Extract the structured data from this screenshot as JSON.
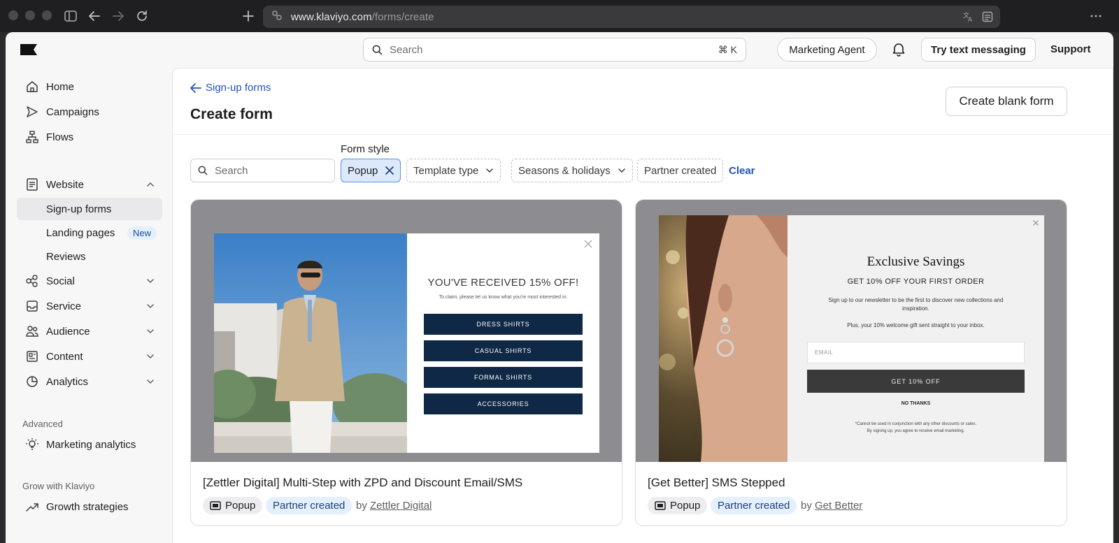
{
  "browser": {
    "url_host": "www.klaviyo.com",
    "url_path": "/forms/create"
  },
  "topbar": {
    "search_placeholder": "Search",
    "search_shortcut": "⌘ K",
    "marketing_agent": "Marketing Agent",
    "try_text": "Try text messaging",
    "support": "Support"
  },
  "sidebar": {
    "home": "Home",
    "campaigns": "Campaigns",
    "flows": "Flows",
    "website": "Website",
    "signup_forms": "Sign-up forms",
    "landing_pages": "Landing pages",
    "landing_badge": "New",
    "reviews": "Reviews",
    "social": "Social",
    "service": "Service",
    "audience": "Audience",
    "content": "Content",
    "analytics": "Analytics",
    "advanced_label": "Advanced",
    "marketing_analytics": "Marketing analytics",
    "grow_label": "Grow with Klaviyo",
    "growth_strategies": "Growth strategies"
  },
  "main": {
    "back": "Sign-up forms",
    "title": "Create form",
    "create_blank": "Create blank form",
    "form_style_label": "Form style",
    "search_placeholder": "Search",
    "active_chip": "Popup",
    "template_type": "Template type",
    "seasons": "Seasons & holidays",
    "partner_created": "Partner created",
    "clear": "Clear"
  },
  "cards": [
    {
      "title": "[Zettler Digital] Multi-Step with ZPD and Discount Email/SMS",
      "tag_style": "Popup",
      "tag_partner": "Partner created",
      "by_prefix": "by",
      "by_name": "Zettler Digital",
      "popup": {
        "headline": "YOU'VE RECEIVED 15% OFF!",
        "sub": "To claim, please let us know what you're most interested in:",
        "buttons": [
          "DRESS SHIRTS",
          "CASUAL SHIRTS",
          "FORMAL SHIRTS",
          "ACCESSORIES"
        ]
      }
    },
    {
      "title": "[Get Better] SMS Stepped",
      "tag_style": "Popup",
      "tag_partner": "Partner created",
      "by_prefix": "by",
      "by_name": "Get Better",
      "popup": {
        "headline": "Exclusive Savings",
        "sub": "GET 10% OFF YOUR FIRST ORDER",
        "body1": "Sign up to our newsletter to be the first to discover new collections and inspiration.",
        "body2": "Plus, your 10% welcome gift sent straight to your inbox.",
        "email_placeholder": "EMAIL",
        "cta": "GET 10% OFF",
        "no_thanks": "NO THANKS",
        "fine1": "*Cannot be used in conjunction with any other discounts or sales.",
        "fine2": "By signing up, you agree to receive email marketing."
      }
    }
  ],
  "colors": {
    "link_blue": "#2154b5",
    "popup_navy": "#0f2846",
    "chip_active_bg": "#dce9fb"
  }
}
